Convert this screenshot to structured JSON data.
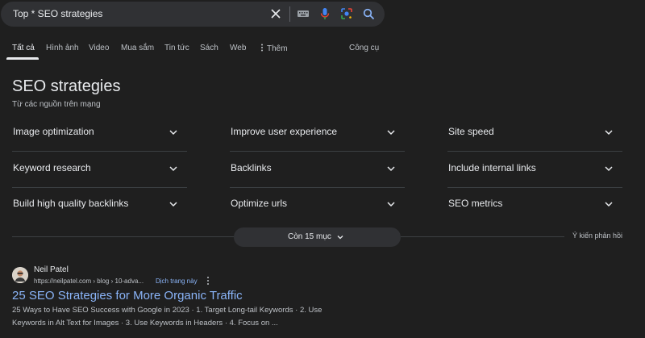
{
  "search": {
    "query": "Top * SEO strategies"
  },
  "tabs": [
    {
      "label": "Tất cả",
      "active": true
    },
    {
      "label": "Hình ảnh"
    },
    {
      "label": "Video"
    },
    {
      "label": "Mua sắm"
    },
    {
      "label": "Tin tức"
    },
    {
      "label": "Sách"
    },
    {
      "label": "Web"
    },
    {
      "label": "Thêm",
      "icon": "more-vert-icon"
    },
    {
      "label": "Công cụ"
    }
  ],
  "panel": {
    "title": "SEO strategies",
    "subtitle": "Từ các nguồn trên mạng",
    "items": [
      "Image optimization",
      "Improve user experience",
      "Site speed",
      "Keyword research",
      "Backlinks",
      "Include internal links",
      "Build high quality backlinks",
      "Optimize urls",
      "SEO metrics"
    ],
    "more_label": "Còn 15 mục",
    "feedback": "Ý kiến phản hồi"
  },
  "result": {
    "site_name": "Neil Patel",
    "url": "https://neilpatel.com › blog › 10-adva...",
    "translate": "Dịch trang này",
    "title": "25 SEO Strategies for More Organic Traffic",
    "snippet_line1": "25 Ways to Have SEO Success with Google in 2023 · 1. Target Long-tail Keywords · 2. Use",
    "snippet_line2": "Keywords in Alt Text for Images · 3. Use Keywords in Headers · 4. Focus on ..."
  },
  "colors": {
    "background": "#1f1f1f",
    "search_bg": "#303134",
    "link": "#8ab4f8",
    "divider": "#3c4043"
  }
}
